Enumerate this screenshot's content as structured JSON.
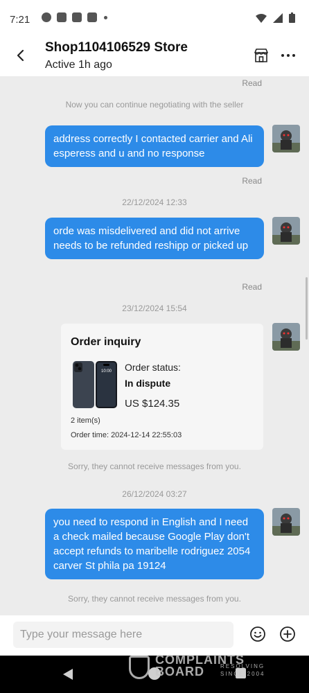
{
  "status_bar": {
    "time": "7:21",
    "left_icons": [
      "chat-bubble-icon",
      "app-icon",
      "facebook-icon",
      "facebook-icon"
    ],
    "right_icons": [
      "wifi-icon",
      "signal-icon",
      "battery-icon"
    ]
  },
  "header": {
    "title": "Shop1104106529 Store",
    "subtitle": "Active 1h ago",
    "icons": [
      "back-arrow-icon",
      "store-icon",
      "more-icon"
    ]
  },
  "chat": {
    "read_label": "Read",
    "system_negotiate": "Now you can continue negotiating with the seller",
    "message_1": "address correctly I contacted carrier and Ali esperess and u and no response",
    "date_1": "22/12/2024 12:33",
    "message_2": "orde was misdelivered and did not arrive needs to be refunded reshipp or picked up",
    "date_2": "23/12/2024 15:54",
    "order_card": {
      "title": "Order inquiry",
      "status_label": "Order status:",
      "status_value": "In dispute",
      "price": "US $124.35",
      "items": "2 item(s)",
      "order_time": "Order time: 2024-12-14 22:55:03",
      "phone_screen_time": "10:00"
    },
    "system_cannot_receive": "Sorry, they cannot receive messages from you.",
    "date_3": "26/12/2024 03:27",
    "message_3": "you need to respond in English and I need a check mailed because Google Play don't accept refunds to maribelle rodriguez 2054 carver St phila pa 19124"
  },
  "input": {
    "placeholder": "Type your message here"
  },
  "watermark": {
    "line1": "COMPLAINTS",
    "line2": "BOARD",
    "line3": "RESOLVING",
    "line4": "SINCE 2004"
  },
  "colors": {
    "bubble": "#2d8be8",
    "background": "#ececec"
  }
}
